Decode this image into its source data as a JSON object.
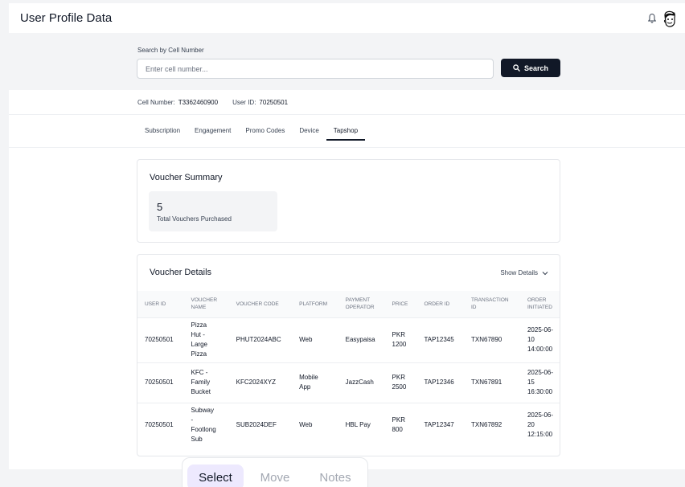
{
  "header": {
    "title": "User Profile Data",
    "bell_icon": "bell-icon",
    "avatar_icon": "avatar-cartoon-icon"
  },
  "search": {
    "label": "Search by Cell Number",
    "placeholder": "Enter cell number...",
    "value": "",
    "button_label": "Search"
  },
  "user_info": {
    "cell_label": "Cell Number:",
    "cell_value": "T3362460900",
    "userid_label": "User ID:",
    "userid_value": "70250501"
  },
  "tabs": [
    {
      "label": "Subscription",
      "active": false
    },
    {
      "label": "Engagement",
      "active": false
    },
    {
      "label": "Promo Codes",
      "active": false
    },
    {
      "label": "Device",
      "active": false
    },
    {
      "label": "Tapshop",
      "active": true
    }
  ],
  "summary": {
    "title": "Voucher Summary",
    "count": "5",
    "count_label": "Total Vouchers Purchased"
  },
  "details": {
    "title": "Voucher Details",
    "toggle_label": "Show Details",
    "columns": [
      "User ID",
      "Voucher Name",
      "Voucher Code",
      "Platform",
      "Payment Operator",
      "Price",
      "Order ID",
      "Transaction ID",
      "Order Initiated"
    ],
    "rows": [
      [
        "70250501",
        "Pizza Hut - Large Pizza",
        "PHUT2024ABC",
        "Web",
        "Easypaisa",
        "PKR 1200",
        "TAP12345",
        "TXN67890",
        "2025-06-10 14:00:00"
      ],
      [
        "70250501",
        "KFC - Family Bucket",
        "KFC2024XYZ",
        "Mobile App",
        "JazzCash",
        "PKR 2500",
        "TAP12346",
        "TXN67891",
        "2025-06-15 16:30:00"
      ],
      [
        "70250501",
        "Subway - Footlong Sub",
        "SUB2024DEF",
        "Web",
        "HBL Pay",
        "PKR 800",
        "TAP12347",
        "TXN67892",
        "2025-06-20 12:15:00"
      ]
    ]
  },
  "toolbar": {
    "items": [
      "Select",
      "Move",
      "Notes"
    ],
    "selected": "Select"
  },
  "colors": {
    "primary": "#111827",
    "selected_bg": "#ede9fe",
    "page_bg": "#f3f4f6"
  }
}
